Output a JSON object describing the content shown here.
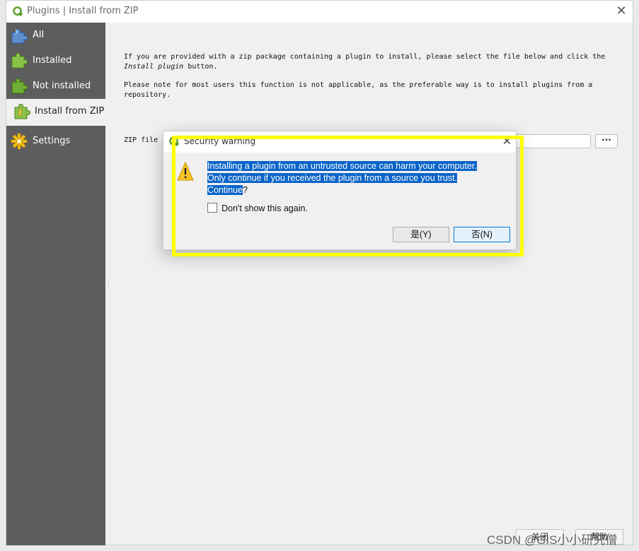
{
  "window": {
    "title": "Plugins | Install from ZIP",
    "close_glyph": "✕"
  },
  "sidebar": {
    "items": [
      {
        "label": "All",
        "icon": "puzzle-all-icon"
      },
      {
        "label": "Installed",
        "icon": "puzzle-installed-icon"
      },
      {
        "label": "Not installed",
        "icon": "puzzle-not-installed-icon"
      },
      {
        "label": "Install from ZIP",
        "icon": "puzzle-zip-icon",
        "active": true
      },
      {
        "label": "Settings",
        "icon": "gear-icon"
      }
    ]
  },
  "content": {
    "intro_line1": "If you are provided with a zip package containing a plugin to install, please select the file below and click the",
    "intro_italic": "Install plugin",
    "intro_line2_rest": " button.",
    "note": "Please note for most users this function is not applicable, as the preferable way is to install plugins from a repository.",
    "zip_label": "ZIP file",
    "zip_value": "",
    "browse_label": "···"
  },
  "dialog": {
    "title": "Security warning",
    "message_line1": "Installing a plugin from an untrusted source can harm your computer.",
    "message_line2": "Only continue if you received the plugin from a source you trust.",
    "message_line3": "Continue",
    "message_line3_tail": "?",
    "checkbox_label": "Don't show this again.",
    "yes_label": "是(Y)",
    "no_label": "否(N)"
  },
  "footer": {
    "close_label": "关闭",
    "help_label": "帮助"
  },
  "watermark": "CSDN @GIS小小研究僧",
  "colors": {
    "sidebar_bg": "#5d5d5d",
    "selection": "#0a64c8",
    "highlight": "#ffff00"
  }
}
